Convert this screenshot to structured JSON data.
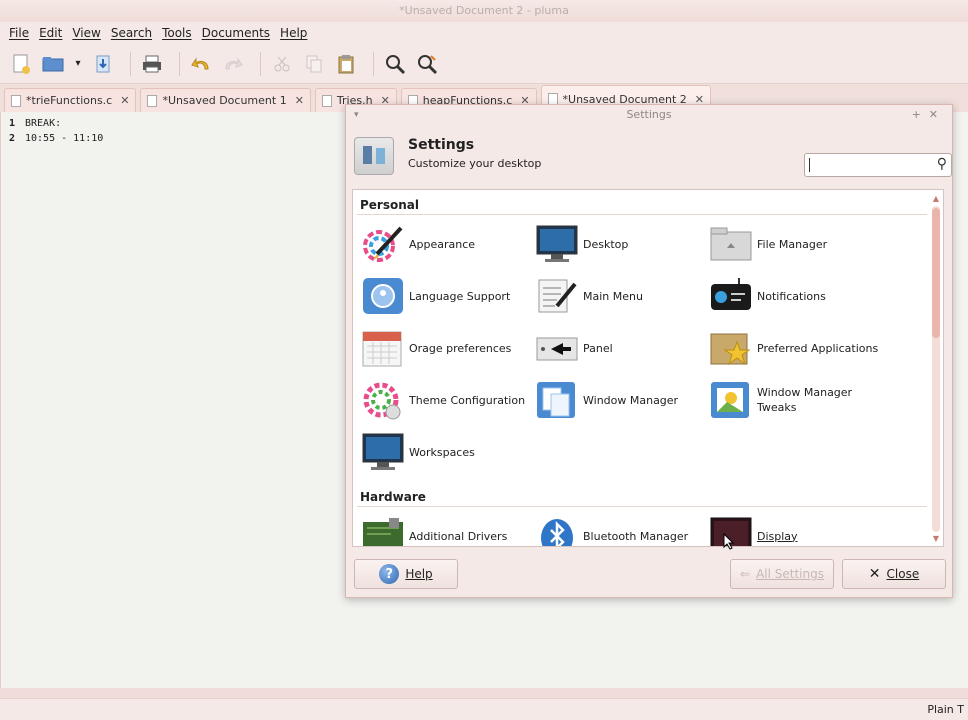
{
  "window": {
    "title": "*Unsaved Document 2 - pluma"
  },
  "menu": [
    "File",
    "Edit",
    "View",
    "Search",
    "Tools",
    "Documents",
    "Help"
  ],
  "toolbar_icons": [
    "new-document-icon",
    "open-icon",
    "dropdown-icon",
    "save-icon",
    "print-icon",
    "undo-icon",
    "redo-icon",
    "cut-icon",
    "copy-icon",
    "paste-icon",
    "find-icon",
    "find-replace-icon"
  ],
  "tabs": [
    {
      "label": "*trieFunctions.c"
    },
    {
      "label": "*Unsaved Document 1"
    },
    {
      "label": "Tries.h"
    },
    {
      "label": "heapFunctions.c"
    },
    {
      "label": "*Unsaved Document 2",
      "active": true
    }
  ],
  "editor": {
    "line_numbers": [
      "1",
      "2"
    ],
    "lines": [
      "BREAK:",
      "10:55 - 11:10"
    ]
  },
  "status": {
    "language": "Plain T"
  },
  "settings": {
    "window_title": "Settings",
    "title": "Settings",
    "subtitle": "Customize your desktop",
    "search_value": "",
    "sections": [
      {
        "name": "Personal",
        "items": [
          {
            "label": "Appearance",
            "icon": "appearance-icon"
          },
          {
            "label": "Desktop",
            "icon": "desktop-icon"
          },
          {
            "label": "File Manager",
            "icon": "file-manager-icon"
          },
          {
            "label": "Language Support",
            "icon": "language-support-icon"
          },
          {
            "label": "Main Menu",
            "icon": "main-menu-icon"
          },
          {
            "label": "Notifications",
            "icon": "notifications-icon"
          },
          {
            "label": "Orage preferences",
            "icon": "calendar-icon"
          },
          {
            "label": "Panel",
            "icon": "panel-icon"
          },
          {
            "label": "Preferred Applications",
            "icon": "preferred-apps-icon"
          },
          {
            "label": "Theme Configuration",
            "icon": "theme-icon"
          },
          {
            "label": "Window Manager",
            "icon": "window-manager-icon"
          },
          {
            "label": "Window Manager Tweaks",
            "icon": "wm-tweaks-icon"
          },
          {
            "label": "Workspaces",
            "icon": "workspaces-icon"
          }
        ]
      },
      {
        "name": "Hardware",
        "items": [
          {
            "label": "Additional Drivers",
            "icon": "drivers-icon"
          },
          {
            "label": "Bluetooth Manager",
            "icon": "bluetooth-icon"
          },
          {
            "label": "Display",
            "icon": "display-icon"
          }
        ]
      }
    ],
    "buttons": {
      "help": "Help",
      "all_settings": "All Settings",
      "close": "Close"
    }
  }
}
